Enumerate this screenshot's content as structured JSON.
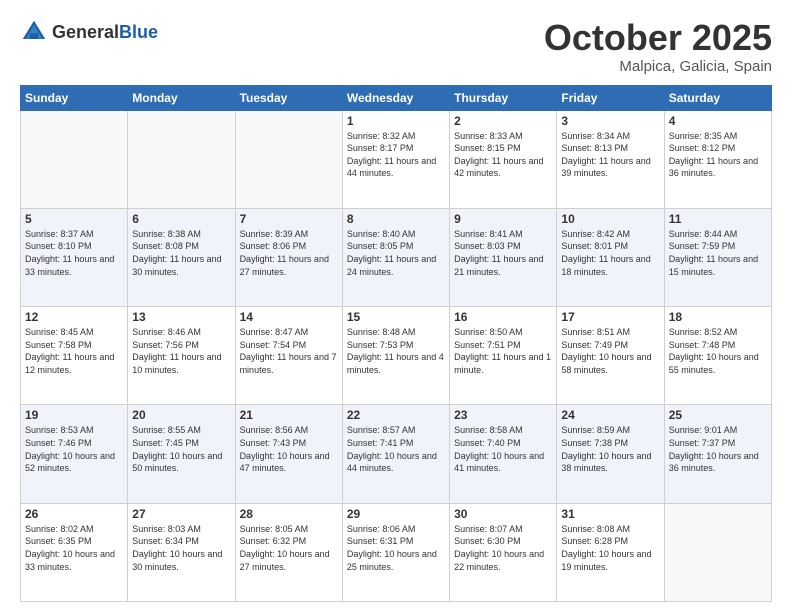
{
  "header": {
    "logo_general": "General",
    "logo_blue": "Blue",
    "month": "October 2025",
    "location": "Malpica, Galicia, Spain"
  },
  "days_of_week": [
    "Sunday",
    "Monday",
    "Tuesday",
    "Wednesday",
    "Thursday",
    "Friday",
    "Saturday"
  ],
  "weeks": [
    [
      {
        "day": "",
        "info": ""
      },
      {
        "day": "",
        "info": ""
      },
      {
        "day": "",
        "info": ""
      },
      {
        "day": "1",
        "info": "Sunrise: 8:32 AM\nSunset: 8:17 PM\nDaylight: 11 hours\nand 44 minutes."
      },
      {
        "day": "2",
        "info": "Sunrise: 8:33 AM\nSunset: 8:15 PM\nDaylight: 11 hours\nand 42 minutes."
      },
      {
        "day": "3",
        "info": "Sunrise: 8:34 AM\nSunset: 8:13 PM\nDaylight: 11 hours\nand 39 minutes."
      },
      {
        "day": "4",
        "info": "Sunrise: 8:35 AM\nSunset: 8:12 PM\nDaylight: 11 hours\nand 36 minutes."
      }
    ],
    [
      {
        "day": "5",
        "info": "Sunrise: 8:37 AM\nSunset: 8:10 PM\nDaylight: 11 hours\nand 33 minutes."
      },
      {
        "day": "6",
        "info": "Sunrise: 8:38 AM\nSunset: 8:08 PM\nDaylight: 11 hours\nand 30 minutes."
      },
      {
        "day": "7",
        "info": "Sunrise: 8:39 AM\nSunset: 8:06 PM\nDaylight: 11 hours\nand 27 minutes."
      },
      {
        "day": "8",
        "info": "Sunrise: 8:40 AM\nSunset: 8:05 PM\nDaylight: 11 hours\nand 24 minutes."
      },
      {
        "day": "9",
        "info": "Sunrise: 8:41 AM\nSunset: 8:03 PM\nDaylight: 11 hours\nand 21 minutes."
      },
      {
        "day": "10",
        "info": "Sunrise: 8:42 AM\nSunset: 8:01 PM\nDaylight: 11 hours\nand 18 minutes."
      },
      {
        "day": "11",
        "info": "Sunrise: 8:44 AM\nSunset: 7:59 PM\nDaylight: 11 hours\nand 15 minutes."
      }
    ],
    [
      {
        "day": "12",
        "info": "Sunrise: 8:45 AM\nSunset: 7:58 PM\nDaylight: 11 hours\nand 12 minutes."
      },
      {
        "day": "13",
        "info": "Sunrise: 8:46 AM\nSunset: 7:56 PM\nDaylight: 11 hours\nand 10 minutes."
      },
      {
        "day": "14",
        "info": "Sunrise: 8:47 AM\nSunset: 7:54 PM\nDaylight: 11 hours\nand 7 minutes."
      },
      {
        "day": "15",
        "info": "Sunrise: 8:48 AM\nSunset: 7:53 PM\nDaylight: 11 hours\nand 4 minutes."
      },
      {
        "day": "16",
        "info": "Sunrise: 8:50 AM\nSunset: 7:51 PM\nDaylight: 11 hours\nand 1 minute."
      },
      {
        "day": "17",
        "info": "Sunrise: 8:51 AM\nSunset: 7:49 PM\nDaylight: 10 hours\nand 58 minutes."
      },
      {
        "day": "18",
        "info": "Sunrise: 8:52 AM\nSunset: 7:48 PM\nDaylight: 10 hours\nand 55 minutes."
      }
    ],
    [
      {
        "day": "19",
        "info": "Sunrise: 8:53 AM\nSunset: 7:46 PM\nDaylight: 10 hours\nand 52 minutes."
      },
      {
        "day": "20",
        "info": "Sunrise: 8:55 AM\nSunset: 7:45 PM\nDaylight: 10 hours\nand 50 minutes."
      },
      {
        "day": "21",
        "info": "Sunrise: 8:56 AM\nSunset: 7:43 PM\nDaylight: 10 hours\nand 47 minutes."
      },
      {
        "day": "22",
        "info": "Sunrise: 8:57 AM\nSunset: 7:41 PM\nDaylight: 10 hours\nand 44 minutes."
      },
      {
        "day": "23",
        "info": "Sunrise: 8:58 AM\nSunset: 7:40 PM\nDaylight: 10 hours\nand 41 minutes."
      },
      {
        "day": "24",
        "info": "Sunrise: 8:59 AM\nSunset: 7:38 PM\nDaylight: 10 hours\nand 38 minutes."
      },
      {
        "day": "25",
        "info": "Sunrise: 9:01 AM\nSunset: 7:37 PM\nDaylight: 10 hours\nand 36 minutes."
      }
    ],
    [
      {
        "day": "26",
        "info": "Sunrise: 8:02 AM\nSunset: 6:35 PM\nDaylight: 10 hours\nand 33 minutes."
      },
      {
        "day": "27",
        "info": "Sunrise: 8:03 AM\nSunset: 6:34 PM\nDaylight: 10 hours\nand 30 minutes."
      },
      {
        "day": "28",
        "info": "Sunrise: 8:05 AM\nSunset: 6:32 PM\nDaylight: 10 hours\nand 27 minutes."
      },
      {
        "day": "29",
        "info": "Sunrise: 8:06 AM\nSunset: 6:31 PM\nDaylight: 10 hours\nand 25 minutes."
      },
      {
        "day": "30",
        "info": "Sunrise: 8:07 AM\nSunset: 6:30 PM\nDaylight: 10 hours\nand 22 minutes."
      },
      {
        "day": "31",
        "info": "Sunrise: 8:08 AM\nSunset: 6:28 PM\nDaylight: 10 hours\nand 19 minutes."
      },
      {
        "day": "",
        "info": ""
      }
    ]
  ]
}
